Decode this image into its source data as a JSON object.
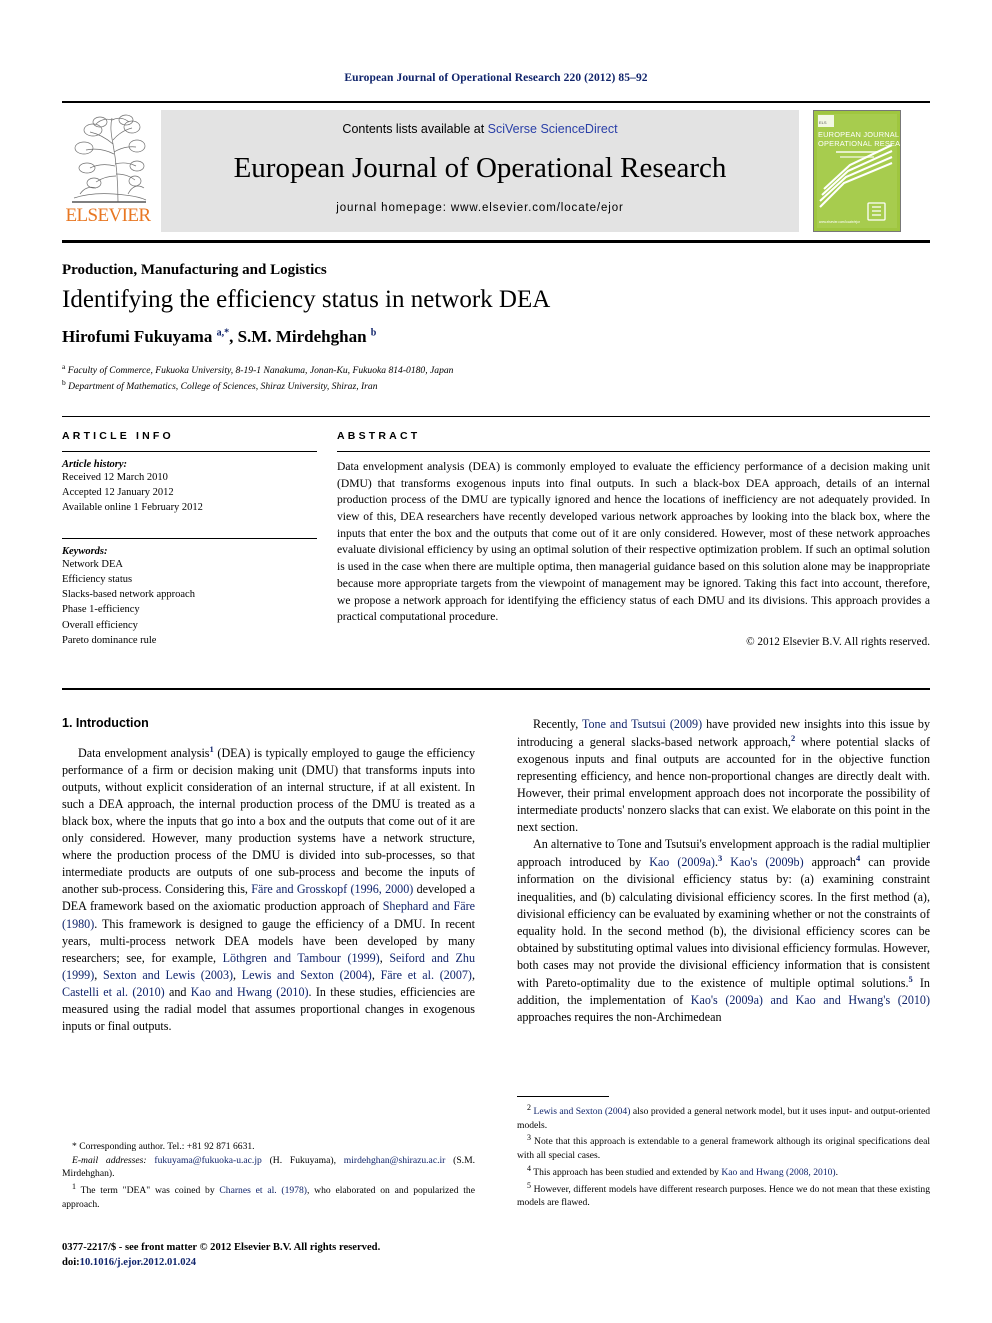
{
  "running_head": "European Journal of Operational Research 220 (2012) 85–92",
  "masthead": {
    "contents_prefix": "Contents lists available at ",
    "sciencedirect": "SciVerse ScienceDirect",
    "journal_name": "European Journal of Operational Research",
    "homepage": "journal homepage: www.elsevier.com/locate/ejor",
    "publisher_name": "ELSEVIER",
    "cover_title_line1": "EUROPEAN JOURNAL OF",
    "cover_title_line2": "OPERATIONAL RESEARCH",
    "cover_logo": "ELSEVIER"
  },
  "article": {
    "section_label": "Production, Manufacturing and Logistics",
    "title": "Identifying the efficiency status in network DEA",
    "authors_html": "Hirofumi Fukuyama <sup>a,*</sup>, S.M. Mirdehghan <sup>b</sup>",
    "affiliation_a": "Faculty of Commerce, Fukuoka University, 8-19-1 Nanakuma, Jonan-Ku, Fukuoka 814-0180, Japan",
    "affiliation_b": "Department of Mathematics, College of Sciences, Shiraz University, Shiraz, Iran"
  },
  "info": {
    "heading": "ARTICLE INFO",
    "history_label": "Article history:",
    "history": [
      "Received 12 March 2010",
      "Accepted 12 January 2012",
      "Available online 1 February 2012"
    ],
    "keywords_label": "Keywords:",
    "keywords": [
      "Network DEA",
      "Efficiency status",
      "Slacks-based network approach",
      "Phase 1-efficiency",
      "Overall efficiency",
      "Pareto dominance rule"
    ]
  },
  "abstract": {
    "heading": "ABSTRACT",
    "text": "Data envelopment analysis (DEA) is commonly employed to evaluate the efficiency performance of a decision making unit (DMU) that transforms exogenous inputs into final outputs. In such a black-box DEA approach, details of an internal production process of the DMU are typically ignored and hence the locations of inefficiency are not adequately provided. In view of this, DEA researchers have recently developed various network approaches by looking into the black box, where the inputs that enter the box and the outputs that come out of it are only considered. However, most of these network approaches evaluate divisional efficiency by using an optimal solution of their respective optimization problem. If such an optimal solution is used in the case when there are multiple optima, then managerial guidance based on this solution alone may be inappropriate because more appropriate targets from the viewpoint of management may be ignored. Taking this fact into account, therefore, we propose a network approach for identifying the efficiency status of each DMU and its divisions. This approach provides a practical computational procedure.",
    "copyright": "© 2012 Elsevier B.V. All rights reserved."
  },
  "body": {
    "intro_heading": "1. Introduction",
    "left_p1_a": "Data envelopment analysis",
    "left_p1_fn": "1",
    "left_p1_b": " (DEA) is typically employed to gauge the efficiency performance of a firm or decision making unit (DMU) that transforms inputs into outputs, without explicit consideration of an internal structure, if at all existent. In such a DEA approach, the internal production process of the DMU is treated as a black box, where the inputs that go into a box and the outputs that come out of it are only considered. However, many production systems have a network structure, where the production process of the DMU is divided into sub-processes, so that intermediate products are outputs of one sub-process and become the inputs of another sub-process. Considering this, ",
    "cite_fare_grosskopf": "Färe and Grosskopf (1996, 2000)",
    "left_p1_c": " developed a DEA framework based on the axiomatic production approach of ",
    "cite_shephard": "Shephard and Färe (1980)",
    "left_p1_d": ". This framework is designed to gauge the efficiency of a DMU. In recent years, multi-process network DEA models have been developed by many researchers; see, for example, ",
    "cite_lothgren": "Löthgren and Tambour (1999)",
    "sep1": ", ",
    "cite_seiford": "Seiford and Zhu (1999)",
    "sep2": ", ",
    "cite_sexton_lewis": "Sexton and Lewis (2003)",
    "sep3": ", ",
    "cite_lewis_sexton": "Lewis and Sexton (2004)",
    "sep4": ", ",
    "cite_fare_etal": "Färe et al. (2007)",
    "sep5": ", ",
    "cite_castelli": "Castelli et al. (2010)",
    "sep6": " and ",
    "cite_kao_hwang": "Kao and Hwang (2010)",
    "left_p1_e": ". In these studies, efficiencies are measured using the radial model that assumes proportional changes in exogenous inputs or final outputs.",
    "right_p1_a": "Recently, ",
    "cite_tone_tsutsui": "Tone and Tsutsui (2009)",
    "right_p1_b": " have provided new insights into this issue by introducing a general slacks-based network approach,",
    "right_p1_fn": "2",
    "right_p1_c": " where potential slacks of exogenous inputs and final outputs are accounted for in the objective function representing efficiency, and hence non-proportional changes are directly dealt with. However, their primal envelopment approach does not incorporate the possibility of intermediate products' nonzero slacks that can exist. We elaborate on this point in the next section.",
    "right_p2_a": "An alternative to Tone and Tsutsui's envelopment approach is the radial multiplier approach introduced by ",
    "cite_kao2009a": "Kao (2009a)",
    "right_p2_fn3": "3",
    "right_p2_b": " ",
    "cite_kao2009b": "Kao's (2009b)",
    "right_p2_c": " approach",
    "right_p2_fn4": "4",
    "right_p2_d": " can provide information on the divisional efficiency status by: (a) examining constraint inequalities, and (b) calculating divisional efficiency scores. In the first method (a), divisional efficiency can be evaluated by examining whether or not the constraints of equality hold. In the second method (b), the divisional efficiency scores can be obtained by substituting optimal values into divisional efficiency formulas. However, both cases may not provide the divisional efficiency information that is consistent with Pareto-optimality due to the existence of multiple optimal solutions.",
    "right_p2_fn5": "5",
    "right_p2_e": " In addition, the implementation of ",
    "cite_kao2009a_2": "Kao's (2009a) and Kao and Hwang's (2010)",
    "right_p2_f": " approaches requires the non-Archimedean"
  },
  "footnotes_left": {
    "corresponding": "* Corresponding author. Tel.: +81 92 871 6631.",
    "email_label": "E-mail addresses:",
    "email_1": "fukuyama@fukuoka-u.ac.jp",
    "email_1_who": " (H. Fukuyama), ",
    "email_2": "mirdehghan@shirazu.ac.ir",
    "email_2_who": " (S.M. Mirdehghan).",
    "fn1_mark": "1",
    "fn1_a": " The term \"DEA\" was coined by ",
    "fn1_cite": "Charnes et al. (1978)",
    "fn1_b": ", who elaborated on and popularized the approach."
  },
  "footnotes_right": [
    {
      "mark": "2",
      "pre": " ",
      "cite": "Lewis and Sexton (2004)",
      "post": " also provided a general network model, but it uses input- and output-oriented models."
    },
    {
      "mark": "3",
      "pre": " Note that this approach is extendable to a general framework although its original specifications deal with all special cases.",
      "cite": "",
      "post": ""
    },
    {
      "mark": "4",
      "pre": " This approach has been studied and extended by ",
      "cite": "Kao and Hwang (2008, 2010)",
      "post": "."
    },
    {
      "mark": "5",
      "pre": " However, different models have different research purposes. Hence we do not mean that these existing models are flawed.",
      "cite": "",
      "post": ""
    }
  ],
  "issn": {
    "line1": "0377-2217/$ - see front matter © 2012 Elsevier B.V. All rights reserved.",
    "doi_label": "doi:",
    "doi": "10.1016/j.ejor.2012.01.024"
  },
  "colors": {
    "link": "#10246b",
    "sciencedirect": "#2b40a8",
    "elsevier_orange": "#e87722",
    "band_gray": "#e3e3e3",
    "cover_green": "#8cc63e"
  }
}
